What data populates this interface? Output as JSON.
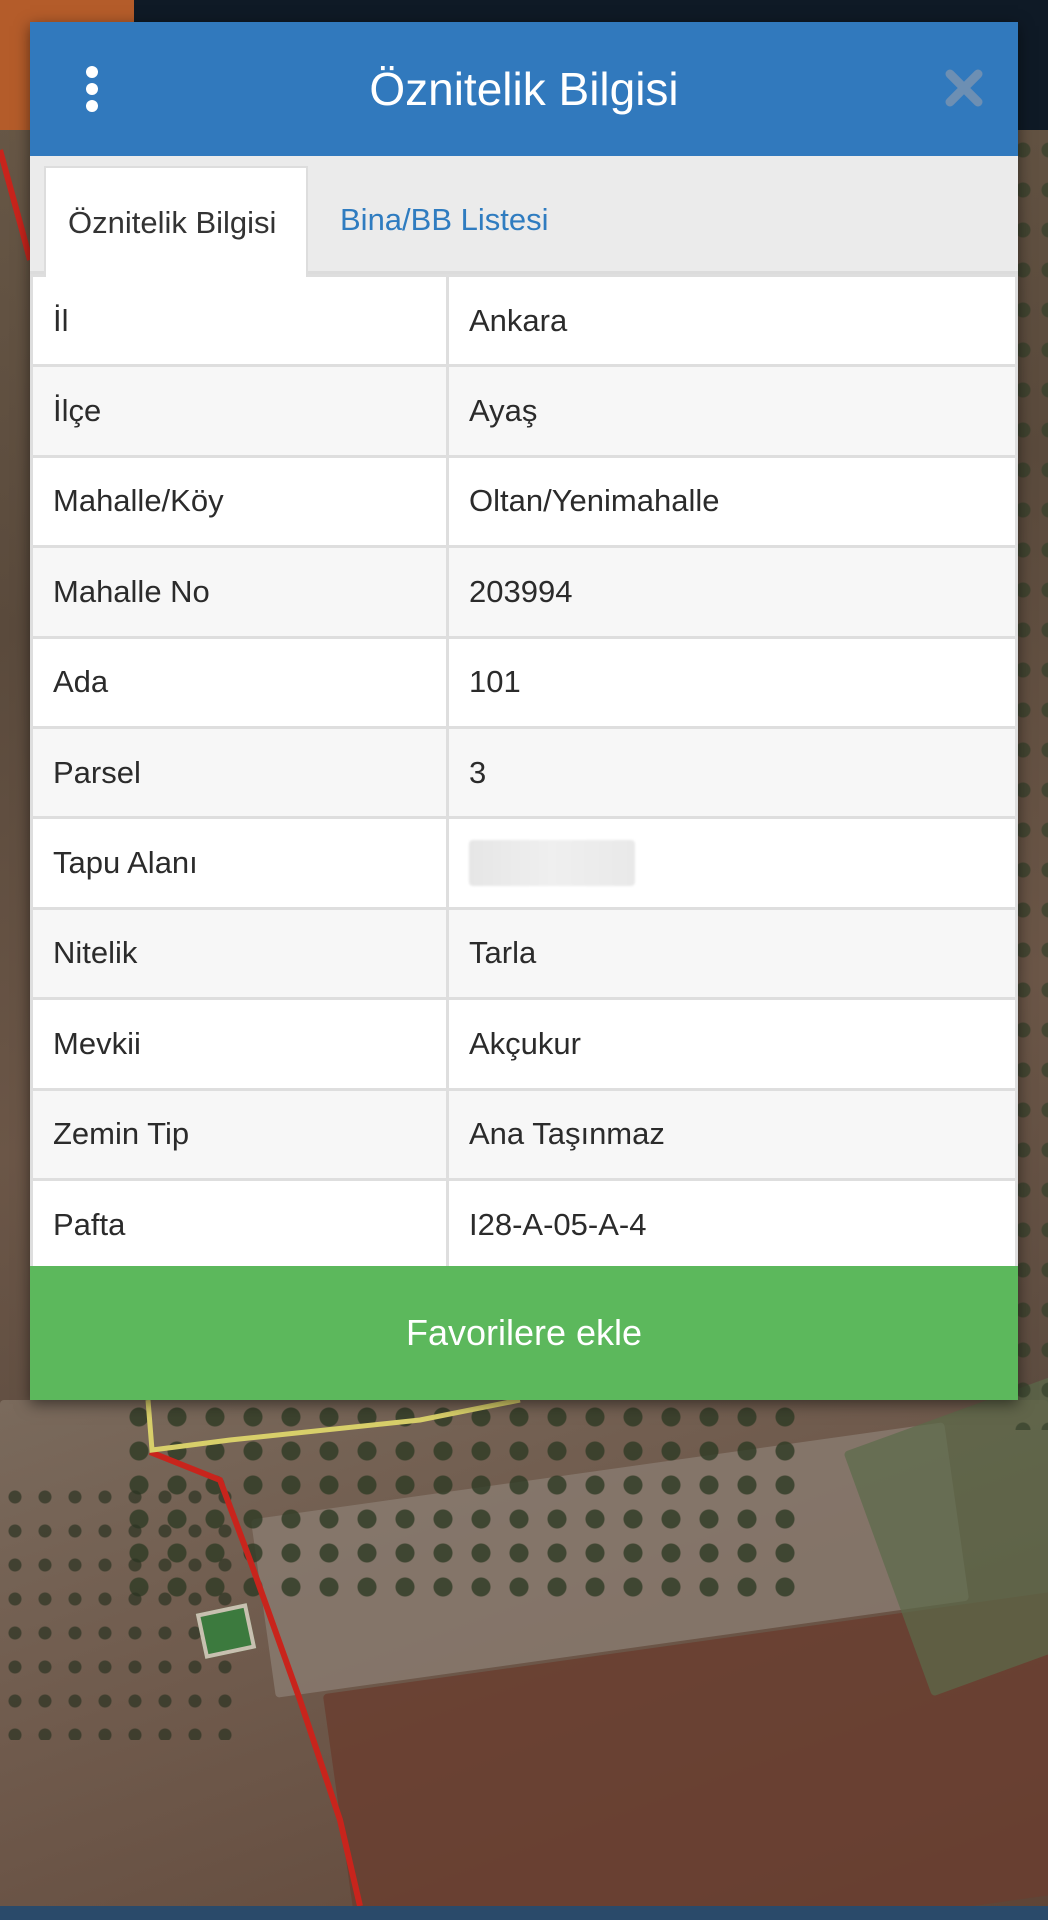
{
  "dialog": {
    "title": "Öznitelik Bilgisi",
    "icons": {
      "menu": "vertical-ellipsis-icon",
      "close": "close-icon"
    },
    "colors": {
      "header": "#3179bd",
      "tab_link": "#2f7cc0",
      "favorite_button": "#5cb85c"
    }
  },
  "tabs": [
    {
      "label": "Öznitelik Bilgisi",
      "active": true
    },
    {
      "label": "Bina/BB Listesi",
      "active": false
    }
  ],
  "attributes": [
    {
      "key": "İl",
      "value": "Ankara"
    },
    {
      "key": "İlçe",
      "value": "Ayaş"
    },
    {
      "key": "Mahalle/Köy",
      "value": "Oltan/Yenimahalle"
    },
    {
      "key": "Mahalle No",
      "value": "203994"
    },
    {
      "key": "Ada",
      "value": "101"
    },
    {
      "key": "Parsel",
      "value": "3"
    },
    {
      "key": "Tapu Alanı",
      "value": ""
    },
    {
      "key": "Nitelik",
      "value": "Tarla"
    },
    {
      "key": "Mevkii",
      "value": "Akçukur"
    },
    {
      "key": "Zemin Tip",
      "value": "Ana Taşınmaz"
    },
    {
      "key": "Pafta",
      "value": "I28-A-05-A-4"
    }
  ],
  "favorite_button": {
    "label": "Favorilere ekle"
  }
}
